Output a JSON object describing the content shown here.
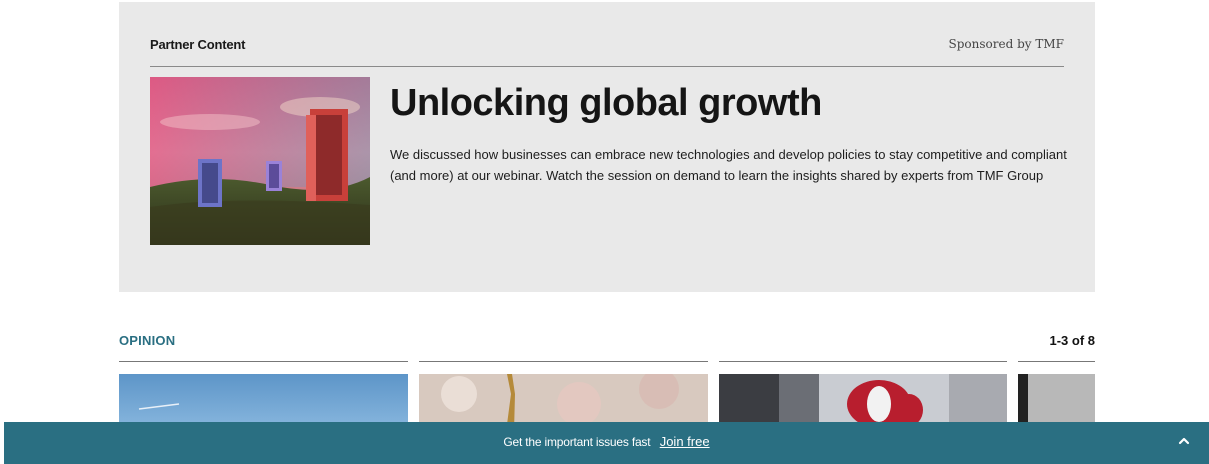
{
  "partner": {
    "label": "Partner Content",
    "sponsor": "Sponsored by TMF",
    "image_icon": "doors-landscape-image",
    "title": "Unlocking global growth",
    "description": "We discussed how businesses can embrace new technologies and develop policies to stay competitive and compliant (and more) at our webinar. Watch the session on demand to learn the insights shared by experts from TMF Group"
  },
  "opinion": {
    "title": "OPINION",
    "pager": "1-3 of 8",
    "cards": [
      {
        "image_icon": "sky-photo"
      },
      {
        "image_icon": "bokeh-photo"
      },
      {
        "image_icon": "skyscraper-balloon-photo"
      },
      {
        "image_icon": "grey-photo"
      }
    ]
  },
  "banner": {
    "text": "Get the important issues fast",
    "link": "Join free",
    "toggle_icon": "chevron-up-icon"
  },
  "colors": {
    "accent": "#2a6f82",
    "panel": "#e9e9e9"
  }
}
